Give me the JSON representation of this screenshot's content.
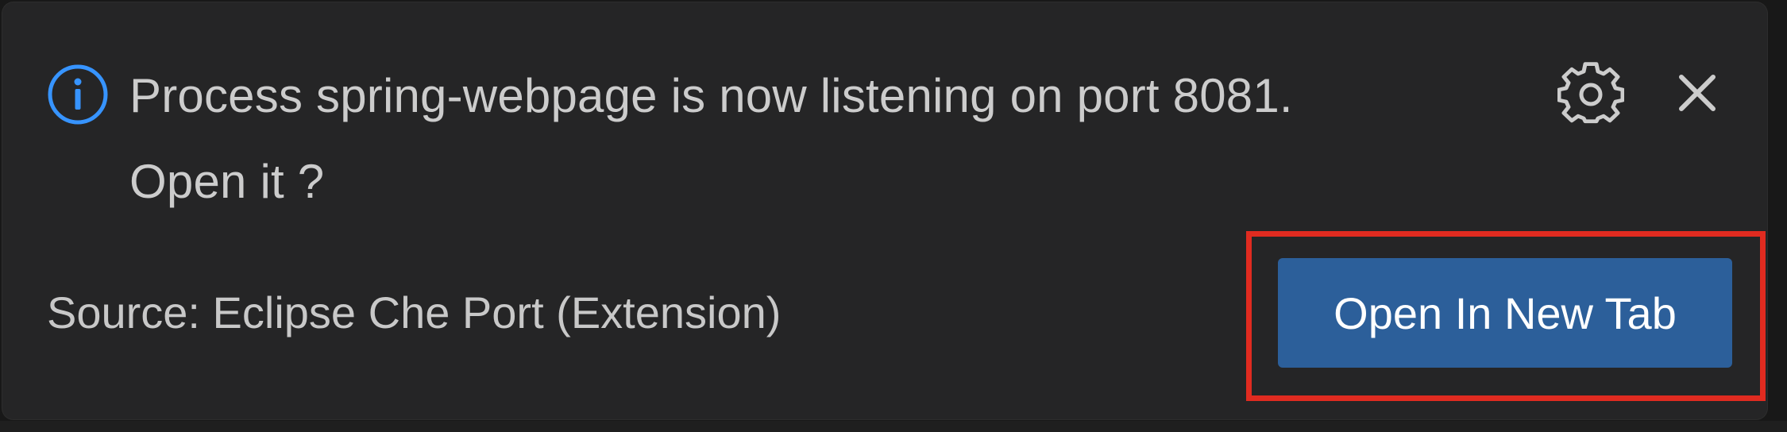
{
  "notification": {
    "message_line1": "Process spring-webpage is now listening on port 8081.",
    "message_line2": "Open it ?",
    "source": "Source: Eclipse Che Port (Extension)",
    "primary_action": "Open In New Tab",
    "icons": {
      "info": "info-icon",
      "settings": "gear-icon",
      "close": "close-icon"
    },
    "colors": {
      "background": "#252526",
      "text": "#cccccc",
      "info_accent": "#3794ff",
      "button": "#2c5f9a",
      "highlight": "#e02b20"
    }
  }
}
